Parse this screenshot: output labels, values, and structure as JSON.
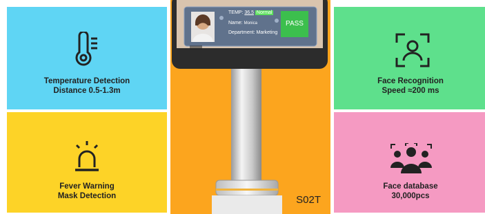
{
  "tiles": {
    "temperature": {
      "line1": "Temperature Detection",
      "line2": "Distance 0.5-1.3m",
      "icon": "thermometer-icon",
      "color": "#5fd5f4"
    },
    "face": {
      "line1": "Face Recognition",
      "line2": "Speed ≈200 ms",
      "icon": "face-scan-icon",
      "color": "#5ee08c"
    },
    "fever": {
      "line1": "Fever Warning",
      "line2": "Mask Detection",
      "icon": "alarm-light-icon",
      "color": "#fdd327"
    },
    "database": {
      "line1": "Face database",
      "line2": "30,000pcs",
      "icon": "group-scan-icon",
      "color": "#f59ac2"
    }
  },
  "device": {
    "temp_label": "TEMP:",
    "temp_value": "36.5",
    "temp_status": "Normal",
    "name_label": "Name:",
    "name_value": "Monica",
    "department_label": "Department:",
    "department_value": "Marketing",
    "pass_label": "PASS",
    "model": "S02T"
  },
  "colors": {
    "center_bg": "#fca51e",
    "pass": "#39c24a",
    "normal": "#5ee05e"
  }
}
